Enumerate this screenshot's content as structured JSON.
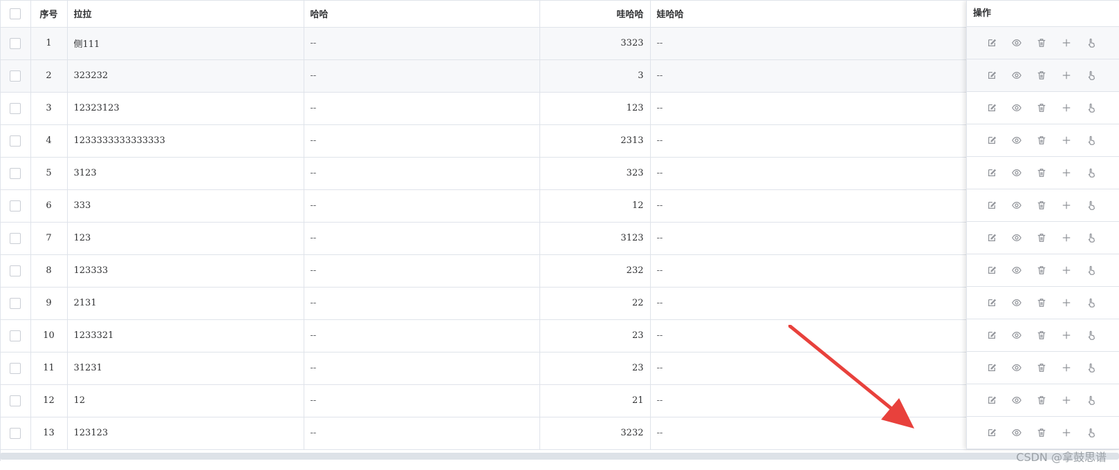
{
  "table": {
    "headers": {
      "index": "序号",
      "lala": "拉拉",
      "haha": "哈哈",
      "wahaha": "哇哈哈",
      "wawahaha": "娃哈哈",
      "actions": "操作"
    },
    "rows": [
      {
        "index": "1",
        "lala": "侧111",
        "haha": "--",
        "wahaha": "3323",
        "wawahaha": "--"
      },
      {
        "index": "2",
        "lala": "323232",
        "haha": "--",
        "wahaha": "3",
        "wawahaha": "--"
      },
      {
        "index": "3",
        "lala": "12323123",
        "haha": "--",
        "wahaha": "123",
        "wawahaha": "--"
      },
      {
        "index": "4",
        "lala": "1233333333333333",
        "haha": "--",
        "wahaha": "2313",
        "wawahaha": "--"
      },
      {
        "index": "5",
        "lala": "3123",
        "haha": "--",
        "wahaha": "323",
        "wawahaha": "--"
      },
      {
        "index": "6",
        "lala": "333",
        "haha": "--",
        "wahaha": "12",
        "wawahaha": "--"
      },
      {
        "index": "7",
        "lala": "123",
        "haha": "--",
        "wahaha": "3123",
        "wawahaha": "--"
      },
      {
        "index": "8",
        "lala": "123333",
        "haha": "--",
        "wahaha": "232",
        "wawahaha": "--"
      },
      {
        "index": "9",
        "lala": "2131",
        "haha": "--",
        "wahaha": "22",
        "wawahaha": "--"
      },
      {
        "index": "10",
        "lala": "1233321",
        "haha": "--",
        "wahaha": "23",
        "wawahaha": "--"
      },
      {
        "index": "11",
        "lala": "31231",
        "haha": "--",
        "wahaha": "23",
        "wawahaha": "--"
      },
      {
        "index": "12",
        "lala": "12",
        "haha": "--",
        "wahaha": "21",
        "wawahaha": "--"
      },
      {
        "index": "13",
        "lala": "123123",
        "haha": "--",
        "wahaha": "3232",
        "wawahaha": "--"
      }
    ],
    "row_actions": [
      "edit-icon",
      "eye-icon",
      "trash-icon",
      "plus-icon",
      "pointer-hand-icon"
    ]
  },
  "colors": {
    "border": "#dfe3ea",
    "icon": "#909399",
    "arrow": "#e8413c",
    "shaded_row": "#f7f8fa"
  },
  "watermark": "CSDN @拿鼓思谱"
}
